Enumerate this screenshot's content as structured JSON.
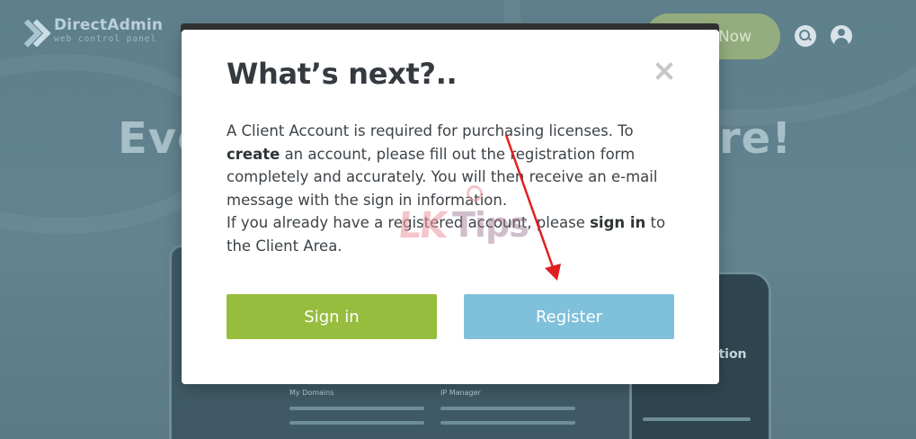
{
  "background": {
    "brand_name": "DirectAdmin",
    "brand_tagline": "web control panel",
    "cta_label": "Now",
    "headline_left": "Eve",
    "headline_right": "re!",
    "panel_titles": [
      "My Domains",
      "IP Manager"
    ],
    "phone_label": "ation",
    "icons": [
      "search-icon",
      "user-icon"
    ]
  },
  "modal": {
    "title": "What’s next?..",
    "close_icon": "close-icon",
    "body": {
      "p1_a": "A Client Account is required for purchasing licenses. To ",
      "p1_bold": "create",
      "p1_b": " an account, please fill out the registration form completely and accurately. You will then receive an e-mail message with the sign in information.",
      "p2_a": "If you already have a registered account, please ",
      "p2_bold": "sign in",
      "p2_b": " to the Client Area."
    },
    "buttons": {
      "signin_label": "Sign in",
      "register_label": "Register"
    }
  },
  "annotation": {
    "arrow_color": "#e02020"
  },
  "watermark": {
    "left": "LK",
    "right": "Tips"
  },
  "colors": {
    "signin": "#97bd3f",
    "register": "#7fc0da",
    "overlay": "#5f7f8c"
  }
}
